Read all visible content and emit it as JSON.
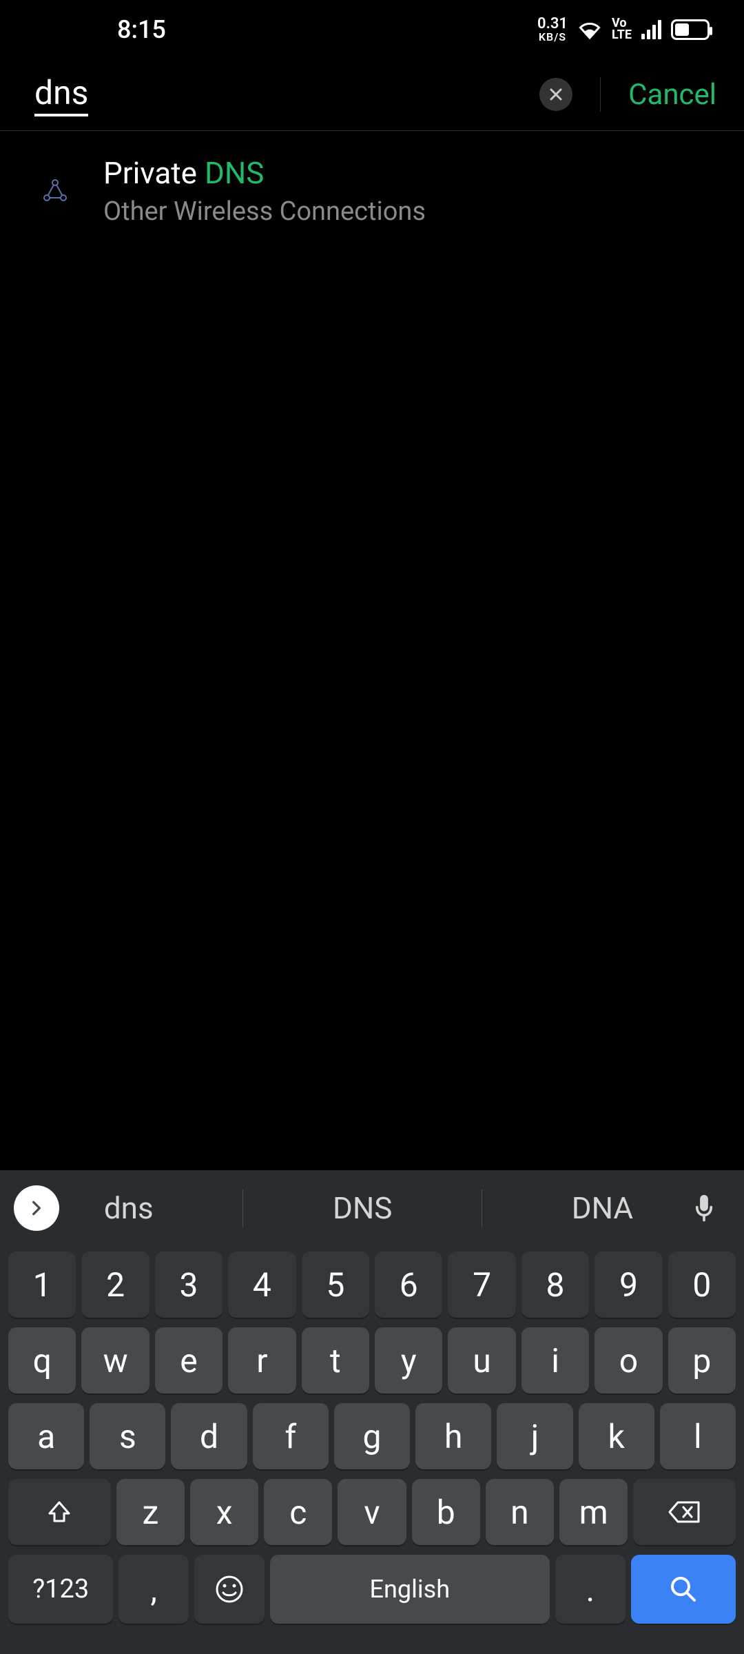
{
  "status": {
    "time": "8:15",
    "net_speed_value": "0.31",
    "net_speed_unit": "KB/S",
    "volte_top": "Vo",
    "volte_bot": "LTE"
  },
  "search": {
    "query": "dns",
    "cancel_label": "Cancel"
  },
  "results": [
    {
      "title_prefix": "Private ",
      "title_highlight": "DNS",
      "subtitle": "Other Wireless Connections"
    }
  ],
  "keyboard": {
    "suggestions": [
      "dns",
      "DNS",
      "DNA"
    ],
    "row_num": [
      "1",
      "2",
      "3",
      "4",
      "5",
      "6",
      "7",
      "8",
      "9",
      "0"
    ],
    "row1": [
      "q",
      "w",
      "e",
      "r",
      "t",
      "y",
      "u",
      "i",
      "o",
      "p"
    ],
    "row2": [
      "a",
      "s",
      "d",
      "f",
      "g",
      "h",
      "j",
      "k",
      "l"
    ],
    "row3": [
      "z",
      "x",
      "c",
      "v",
      "b",
      "n",
      "m"
    ],
    "symbols_key": "?123",
    "comma_key": ",",
    "period_key": ".",
    "space_label": "English"
  }
}
